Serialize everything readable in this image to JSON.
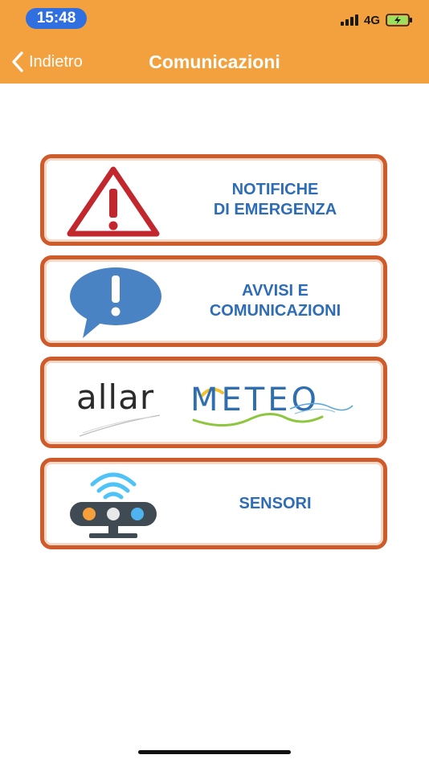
{
  "status_bar": {
    "time": "15:48",
    "network": "4G"
  },
  "nav": {
    "back_label": "Indietro",
    "title": "Comunicazioni"
  },
  "menu": {
    "items": [
      {
        "icon": "warning-triangle-icon",
        "line1": "NOTIFICHE",
        "line2": "DI EMERGENZA"
      },
      {
        "icon": "speech-bubble-exclamation-icon",
        "line1": "AVVISI E",
        "line2": "COMUNICAZIONI"
      },
      {
        "icon": "allarmeteo-logo",
        "logo_dark": "allar",
        "logo_blue": "METEO"
      },
      {
        "icon": "wireless-sensor-icon",
        "line1": "SENSORI"
      }
    ]
  },
  "colors": {
    "header": "#F2A13E",
    "card_border": "#CF5A2A",
    "label_text": "#2E6DB5",
    "warning_red": "#C1272D",
    "bubble_blue": "#4A83C4",
    "time_pill": "#2F6FE0"
  }
}
